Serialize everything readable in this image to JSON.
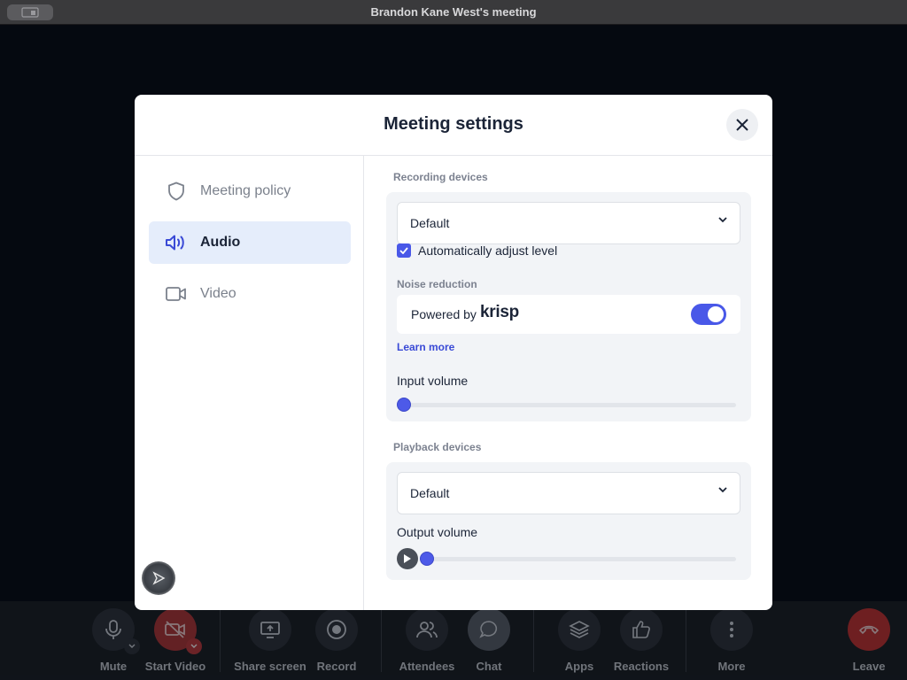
{
  "window": {
    "title": "Brandon Kane West's meeting"
  },
  "modal": {
    "title": "Meeting settings",
    "close_icon": "close-icon"
  },
  "sidebar": {
    "items": [
      {
        "label": "Meeting policy",
        "icon": "shield-icon",
        "active": false
      },
      {
        "label": "Audio",
        "icon": "speaker-icon",
        "active": true
      },
      {
        "label": "Video",
        "icon": "video-camera-icon",
        "active": false
      }
    ]
  },
  "audio": {
    "recording": {
      "section_label": "Recording devices",
      "device_value": "Default",
      "auto_adjust_label": "Automatically adjust level",
      "auto_adjust_checked": true,
      "noise_label": "Noise reduction",
      "powered_by": "Powered by",
      "brand": "krisp",
      "noise_enabled": true,
      "learn_more": "Learn more",
      "input_volume_label": "Input volume",
      "input_volume": 0
    },
    "playback": {
      "section_label": "Playback devices",
      "device_value": "Default",
      "output_volume_label": "Output volume",
      "output_volume": 0
    }
  },
  "toolbar": {
    "mute": "Mute",
    "start_video": "Start Video",
    "share_screen": "Share screen",
    "record": "Record",
    "attendees": "Attendees",
    "chat": "Chat",
    "apps": "Apps",
    "reactions": "Reactions",
    "more": "More",
    "leave": "Leave"
  },
  "colors": {
    "accent": "#4958e8",
    "active_nav_bg": "#e5edfb",
    "leave_red": "#c4322f",
    "video_red": "#c03a3a"
  }
}
